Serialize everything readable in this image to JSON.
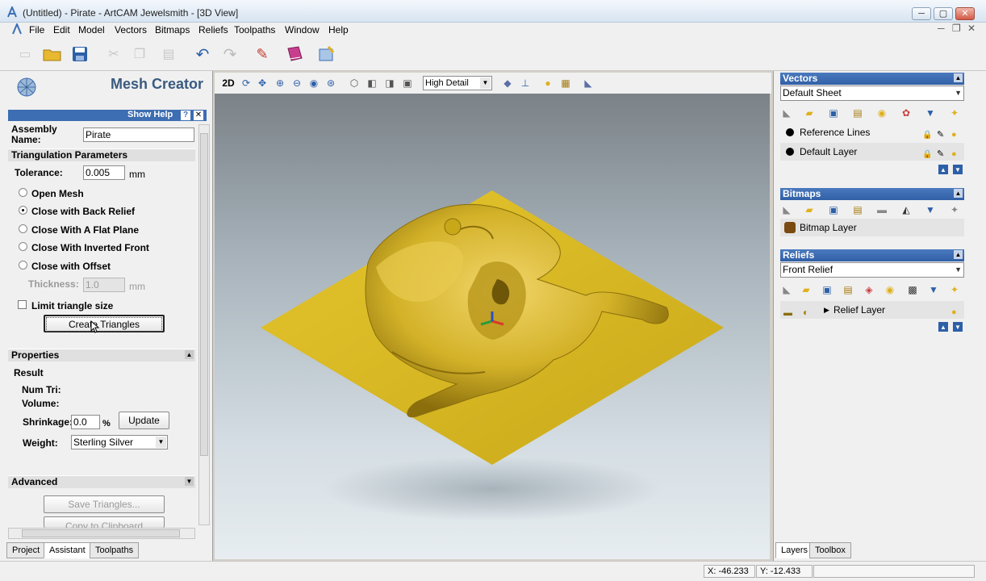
{
  "window": {
    "title": "(Untitled) - Pirate - ArtCAM Jewelsmith - [3D View]"
  },
  "menu": [
    "File",
    "Edit",
    "Model",
    "Vectors",
    "Bitmaps",
    "Reliefs",
    "Toolpaths",
    "Window",
    "Help"
  ],
  "mesh_creator": {
    "title": "Mesh Creator",
    "show_help": "Show Help",
    "assembly_name_label": "Assembly Name:",
    "assembly_name": "Pirate",
    "triangulation_header": "Triangulation Parameters",
    "tolerance_label": "Tolerance:",
    "tolerance": "0.005",
    "tolerance_unit": "mm",
    "options": [
      "Open Mesh",
      "Close with Back Relief",
      "Close With A Flat Plane",
      "Close With Inverted Front",
      "Close with Offset"
    ],
    "selected_option": "Close with Back Relief",
    "thickness_label": "Thickness:",
    "thickness": "1.0",
    "thickness_unit": "mm",
    "limit_label": "Limit triangle size",
    "limit_checked": false,
    "create_button": "Create Triangles",
    "properties_header": "Properties",
    "result_label": "Result",
    "num_tri_label": "Num Tri:",
    "volume_label": "Volume:",
    "shrinkage_label": "Shrinkage:",
    "shrinkage": "0.0",
    "shrinkage_unit": "%",
    "update_button": "Update",
    "weight_label": "Weight:",
    "weight": "Sterling Silver",
    "advanced_header": "Advanced",
    "save_button": "Save Triangles...",
    "copy_button": "Copy to Clipboard"
  },
  "left_tabs": [
    "Project",
    "Assistant",
    "Toolpaths"
  ],
  "left_active_tab": "Assistant",
  "view_toolbar": {
    "mode_2d": "2D",
    "detail": "High Detail"
  },
  "vectors": {
    "header": "Vectors",
    "sheet": "Default Sheet",
    "layers": [
      "Reference Lines",
      "Default Layer"
    ]
  },
  "bitmaps": {
    "header": "Bitmaps",
    "layers": [
      "Bitmap Layer"
    ]
  },
  "reliefs": {
    "header": "Reliefs",
    "relief": "Front Relief",
    "layers": [
      "Relief Layer"
    ]
  },
  "right_tabs": [
    "Layers",
    "Toolbox"
  ],
  "right_active_tab": "Layers",
  "status": {
    "x": "X: -46.233",
    "y": "Y: -12.433"
  },
  "colors": {
    "relief": "#d9b823",
    "header_blue": "#3d6db2"
  }
}
